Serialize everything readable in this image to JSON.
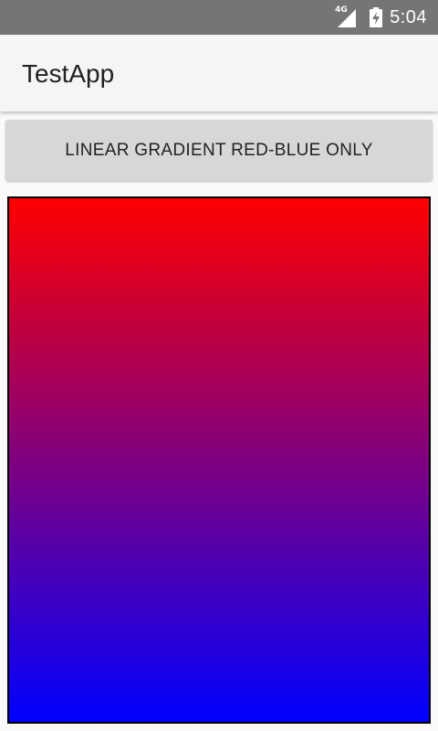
{
  "status_bar": {
    "network_type": "4G",
    "time": "5:04",
    "icons": [
      "signal-icon",
      "battery-charging-icon"
    ],
    "background_color": "#757575"
  },
  "app_bar": {
    "title": "TestApp",
    "background_color": "#F5F5F5"
  },
  "main": {
    "button_label": "LINEAR GRADIENT RED-BLUE ONLY",
    "gradient": {
      "type": "linear",
      "direction": "top-to-bottom",
      "start_color": "#FF0000",
      "end_color": "#0000FF",
      "border_color": "#000000"
    }
  }
}
